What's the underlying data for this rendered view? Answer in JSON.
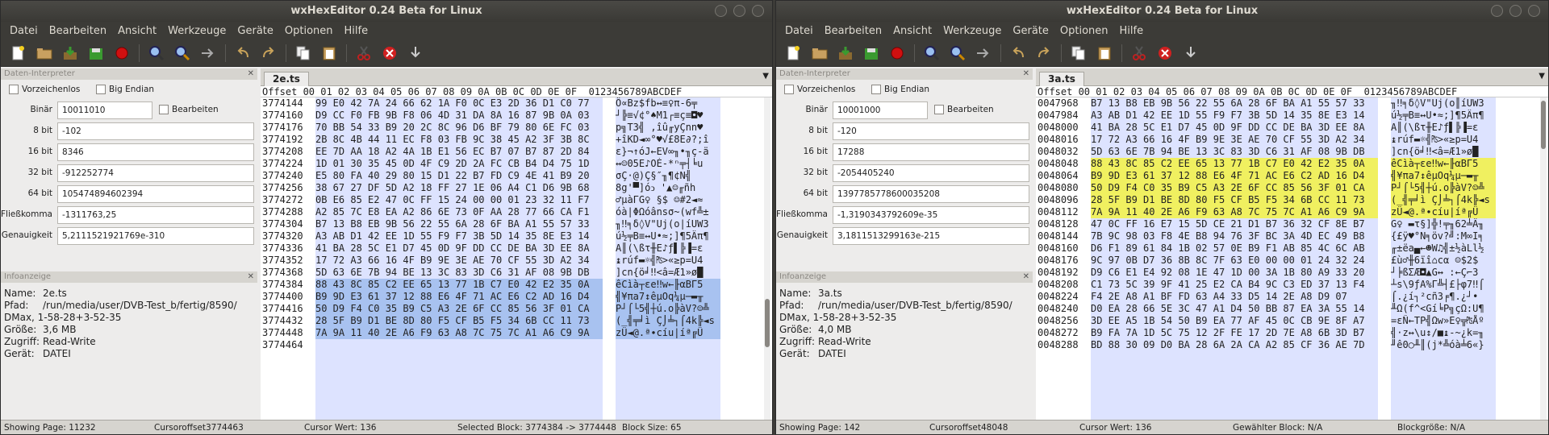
{
  "app_title": "wxHexEditor 0.24 Beta for Linux",
  "menu": [
    "Datei",
    "Bearbeiten",
    "Ansicht",
    "Werkzeuge",
    "Geräte",
    "Optionen",
    "Hilfe"
  ],
  "panels": {
    "interpreter": "Daten-Interpreter",
    "info": "Infoanzeige"
  },
  "labels": {
    "unsigned": "Vorzeichenlos",
    "bigendian": "Big Endian",
    "edit": "Bearbeiten",
    "binary": "Binär",
    "b8": "8 bit",
    "b16": "16 bit",
    "b32": "32 bit",
    "b64": "64 bit",
    "float": "Fließkomma",
    "double": "Doppelte Genauigkeit",
    "name": "Name:",
    "path": "Pfad:",
    "size": "Größe:",
    "access": "Zugriff:",
    "device": "Gerät:"
  },
  "hex_header": "Offset 00 01 02 03 04 05 06 07 08 09 0A 0B 0C 0D 0E 0F  0123456789ABCDEF",
  "left": {
    "tab": "2e.ts",
    "interp": {
      "binary": "10011010",
      "b8": "-102",
      "b16": "8346",
      "b32": "-912252774",
      "b64": "105474894602394",
      "float": "-1311763,25",
      "double": "5,2111521921769e-310"
    },
    "info": {
      "name": "2e.ts",
      "path": "/run/media/user/DVB-Test_b/fertig/8590/",
      "path2": "DMax, 1-58-28+3-52-35",
      "size": "3,6 MB",
      "access": "Read-Write",
      "device": "DATEI"
    },
    "offsets": [
      "3774144",
      "3774160",
      "3774176",
      "3774192",
      "3774208",
      "3774224",
      "3774240",
      "3774256",
      "3774272",
      "3774288",
      "3774304",
      "3774320",
      "3774336",
      "3774352",
      "3774368",
      "3774384",
      "3774400",
      "3774416",
      "3774432",
      "3774448",
      "3774464"
    ],
    "hex": [
      "99 E0 42 7A 24 66 62 1A F0 0C E3 2D 36 D1 C0 77",
      "D9 CC F0 FB 9B F8 06 4D 31 DA 8A 16 87 9B 0A 03",
      "70 BB 54 33 B9 20 2C 8C 96 D6 BF 79 80 6E FC 03",
      "2B 8C 4B 44 11 EC F8 03 FB 9C 38 45 A2 3F 3B 8C",
      "EE 7D AA 18 A2 4A 1B E1 56 EC B7 07 B7 87 2D 84",
      "1D 01 30 35 45 0D 4F C9 2D 2A FC CB B4 D4 75 1D",
      "E5 80 FA 40 29 80 15 D1 22 B7 FD C9 4E 41 B9 20",
      "38 67 27 DF 5D A2 18 FF 27 1E 06 A4 C1 D6 9B 68",
      "0B E6 85 E2 47 0C FF 15 24 00 00 01 23 32 11 F7",
      "A2 85 7C E8 EA A2 86 6E 73 0F AA 28 77 66 CA F1",
      "B7 13 B8 EB 9B 56 22 55 6A 28 6F BA A1 55 57 33",
      "A3 AB D1 42 EE 1D 55 F9 F7 3B 5D 14 35 8E E3 14",
      "41 BA 28 5C E1 D7 45 0D 9F DD CC DE BA 3D EE 8A",
      "17 72 A3 66 16 4F B9 9E 3E AE 70 CF 55 3D A2 34",
      "5D 63 6E 7B 94 BE 13 3C 83 3D C6 31 AF 08 9B DB",
      "88 43 8C 85 C2 EE 65 13 77 1B C7 E0 42 E2 35 0A",
      "B9 9D E3 61 37 12 88 E6 4F 71 AC E6 C2 AD 16 D4",
      "50 D9 F4 C0 35 B9 C5 A3 2E 6F CC 85 56 3F 01 CA",
      "28 5F B9 D1 BE 8D 80 F5 CF B5 F5 34 6B CC 11 73",
      "7A 9A 11 40 2E A6 F9 63 A8 7C 75 7C A1 A6 C9 9A",
      ""
    ],
    "text": [
      "Ö∝Bz$fb↔≡♀π-6╤",
      "┘╠≡√¢°♠M1┌≡ç≡◘♥",
      "p╗T3╣ ,îû╓yÇnn♥",
      "+îKD◄∞°♥√£8E∂?;î",
      "ε}¬↑óJ←EV∞╖•╖ç-ä",
      "↔☺05E♪OÉ-*ⁿ╤┤╘u",
      "σÇ·@)Ç§″╖¶¢N╣",
      "8g'▀]óↄ '▲☺╓ñh",
      "♂µàΓG♀ §$ ☺#2◄≈",
      "óà|ΦΩóânsσ~(wf╩±",
      "╖‼╕δ◊V\"Uj(o|íUW3",
      "ú½╤B≡↔U•≈;]¶5Äπ¶",
      "A║(\\ßτ╫E♪ƒ▌╠▐=ε",
      "↨rúf▬☼╣₧>«≥p=U4",
      "]cn{ö╛‼<â=Æ1»ø█",
      "êCìà┬εe‼w←╟αBΓ5",
      "╣¥πa7↕êµOq¼µ─▬╥",
      "P┘⌠└5╣┼ú.o╠àV?☺╩",
      "(_╣╤╛ì Ç⌡╧┐⌠4k╠◄s",
      "zÜ◄@.ª∙cíu|íª╔Ü",
      ""
    ],
    "sel_from": 15,
    "status": {
      "page": "Showing Page: 11232",
      "cursor": "Cursoroffset3774463",
      "value": "Cursor Wert: 136",
      "block": "Selected Block: 3774384 -> 3774448",
      "size": "Block Size: 65"
    }
  },
  "right": {
    "tab": "3a.ts",
    "interp": {
      "binary": "10001000",
      "b8": "-120",
      "b16": "17288",
      "b32": "-2054405240",
      "b64": "1397785778600035208",
      "float": "-1,3190343792609e-35",
      "double": "3,1811513299163e-215"
    },
    "info": {
      "name": "3a.ts",
      "path": "/run/media/user/DVB-Test_b/fertig/8590/",
      "path2": "DMax, 1-58-28+3-52-35",
      "size": "4,0 MB",
      "access": "Read-Write",
      "device": "DATEI"
    },
    "offsets": [
      "0047968",
      "0047984",
      "0048000",
      "0048016",
      "0048032",
      "0048048",
      "0048064",
      "0048080",
      "0048096",
      "0048112",
      "0048128",
      "0048144",
      "0048160",
      "0048176",
      "0048192",
      "0048208",
      "0048224",
      "0048240",
      "0048256",
      "0048272",
      "0048288"
    ],
    "hex": [
      "B7 13 B8 EB 9B 56 22 55 6A 28 6F BA A1 55 57 33",
      "A3 AB D1 42 EE 1D 55 F9 F7 3B 5D 14 35 8E E3 14",
      "41 BA 28 5C E1 D7 45 0D 9F DD CC DE BA 3D EE 8A",
      "17 72 A3 66 16 4F B9 9E 3E AE 70 CF 55 3D A2 34",
      "5D 63 6E 7B 94 BE 13 3C 83 3D C6 31 AF 08 9B DB",
      "88 43 8C 85 C2 EE 65 13 77 1B C7 E0 42 E2 35 0A",
      "B9 9D E3 61 37 12 88 E6 4F 71 AC E6 C2 AD 16 D4",
      "50 D9 F4 C0 35 B9 C5 A3 2E 6F CC 85 56 3F 01 CA",
      "28 5F B9 D1 BE 8D 80 F5 CF B5 F5 34 6B CC 11 73",
      "7A 9A 11 40 2E A6 F9 63 A8 7C 75 7C A1 A6 C9 9A",
      "47 0C FF 16 E7 15 5D CE 21 D1 B7 36 32 CF 8E B7",
      "7B 9C 98 03 F8 4E B8 94 76 3F BC 3A 4D EC 49 B8",
      "D6 F1 89 61 84 1B 02 57 0E B9 F1 AB 85 4C 6C AB",
      "9C 97 0B D7 36 8B 8C 7F 63 E0 00 00 01 24 32 24",
      "D9 C6 E1 E4 92 08 1E 47 1D 00 3A 1B 80 A9 33 20",
      "C1 73 5C 39 9F 41 25 E2 CA B4 9C C3 ED 37 13 F4",
      "F4 2E A8 A1 BF FD 63 A4 33 D5 14 2E A8 D9 07",
      "D0 EA 28 66 5E 3C 47 A1 D4 50 BB 87 EA 3A 55 14",
      "3D EE A5 1B 54 50 B9 EA 77 AF 45 0C CB 9E 8F A7",
      "B9 FA 7A 1D 5C 75 12 2F FE 17 2D 7E A8 6B 3D B7",
      "BD 88 30 09 D0 BA 28 6A 2A CA A2 85 CF 36 AE 7D"
    ],
    "text": [
      "╖‼╕δ◊V\"Uj(o║íUW3",
      "ú½╤B≡↔U•≈;]¶5Äπ¶",
      "A║(\\ßτ╫E♪ƒ▌╠▐=ε",
      "↨rúf▬☼╣₧>«≥p=U4",
      "]cn{ö╛‼<â=Æ1»ø█",
      "êCìà┬εe‼w←╟αBΓ5",
      "╣¥πa7↕êµOq¼µ─▬╥",
      "P┘⌠└5╣┼ú.o╠àV?☺╩",
      "(_╣╤╛ì Ç⌡╧┐⌠4k╠◄s",
      "zÜ◄@.ª∙cíu|íª╔Ü",
      "G♀ ▬τ§]╬!╤╖62╧Ä╖",
      "{£ÿ♥°N╕öv?╝:M∞I╕",
      "╓±ëa▄←☻W♫╣±½àLl½",
      "£ù♂╫6ïî⌂cα ☺$2$",
      "┘╞ßΣÆ◘▲G↔ :←Ç⌐3",
      "┴s\\9ƒA%Γ╩┤£├φ7‼⌠",
      "⌠.¿í┐²cñ3╒¶.¿┘•",
      "╨Ω(f^<Gí╘P╗çΩ:U¶",
      "=εÑ←TP╣Ωw»E♀╦₧Åº",
      "╣·z↔\\u↕/■↨-~¿k=╖",
      "╜ê0○╨║(j*╩óà╧6«}"
    ],
    "sel_yellow": [
      5,
      10
    ],
    "status": {
      "page": "Showing Page: 142",
      "cursor": "Cursoroffset48048",
      "value": "Cursor Wert: 136",
      "block": "Gewählter Block: N/A",
      "size": "Blockgröße: N/A"
    }
  }
}
